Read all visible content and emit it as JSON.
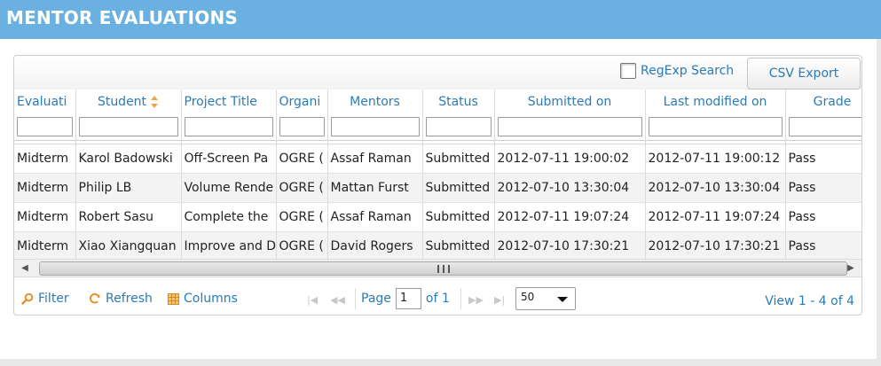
{
  "page": {
    "title": "MENTOR EVALUATIONS"
  },
  "toolbar": {
    "regexp_label": "RegExp Search",
    "csv_label": "CSV Export"
  },
  "table": {
    "columns": [
      "Evaluati",
      "Student",
      "Project Title",
      "Organi",
      "Mentors",
      "Status",
      "Submitted on",
      "Last modified on",
      "Grade"
    ],
    "rows": [
      [
        "Midterm",
        "Karol Badowski",
        "Off-Screen Pa",
        "OGRE (",
        "Assaf Raman",
        "Submitted",
        "2012-07-11 19:00:02",
        "2012-07-11 19:00:12",
        "Pass"
      ],
      [
        "Midterm",
        "Philip LB",
        "Volume Rende",
        "OGRE (",
        "Mattan Furst",
        "Submitted",
        "2012-07-10 13:30:04",
        "2012-07-10 13:30:04",
        "Pass"
      ],
      [
        "Midterm",
        "Robert Sasu",
        "Complete the",
        "OGRE (",
        "Assaf Raman",
        "Submitted",
        "2012-07-11 19:07:24",
        "2012-07-11 19:07:24",
        "Pass"
      ],
      [
        "Midterm",
        "Xiao Xiangquan",
        "Improve and D",
        "OGRE (",
        "David Rogers",
        "Submitted",
        "2012-07-10 17:30:21",
        "2012-07-10 17:30:21",
        "Pass"
      ]
    ]
  },
  "pager": {
    "filter_label": "Filter",
    "refresh_label": "Refresh",
    "columns_label": "Columns",
    "page_label": "Page",
    "page_value": "1",
    "of_label": "of 1",
    "rows_per_page": "50",
    "view_info": "View 1 - 4 of 4"
  },
  "colors": {
    "header_bar": "#6ab0e0",
    "link": "#2a7ab8",
    "status_ok": "#1a7a1a",
    "accent_icon": "#e8912a"
  },
  "icons": [
    "sort-icon",
    "filter-icon",
    "refresh-icon",
    "columns-icon",
    "first-page-icon",
    "prev-page-icon",
    "next-page-icon",
    "last-page-icon",
    "scroll-left-icon",
    "scroll-right-icon"
  ]
}
